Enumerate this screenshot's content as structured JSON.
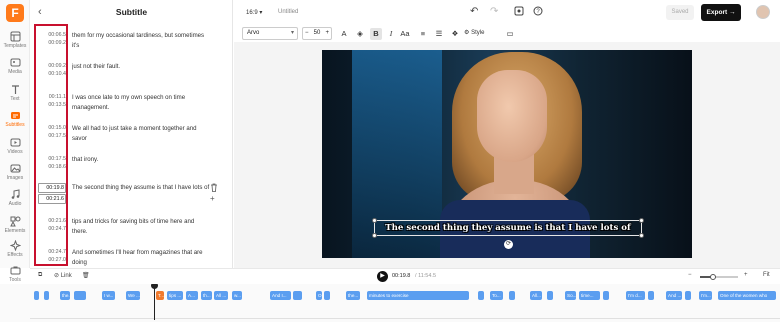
{
  "rail": {
    "logo": "F",
    "items": [
      {
        "label": "Templates",
        "icon": "templates-icon",
        "active": false
      },
      {
        "label": "Media",
        "icon": "media-icon",
        "active": false
      },
      {
        "label": "Text",
        "icon": "text-icon",
        "active": false
      },
      {
        "label": "Subtitles",
        "icon": "subtitles-icon",
        "active": true
      },
      {
        "label": "Videos",
        "icon": "videos-icon",
        "active": false
      },
      {
        "label": "Images",
        "icon": "images-icon",
        "active": false
      },
      {
        "label": "Audio",
        "icon": "audio-icon",
        "active": false
      },
      {
        "label": "Elements",
        "icon": "elements-icon",
        "active": false
      },
      {
        "label": "Effects",
        "icon": "effects-icon",
        "active": false
      },
      {
        "label": "Tools",
        "icon": "tools-icon",
        "active": false
      }
    ]
  },
  "panel": {
    "title": "Subtitle",
    "subtitles": [
      {
        "start": "00:06.5",
        "end": "00:09.2",
        "text": "them for my occasional tardiness, but sometimes it's"
      },
      {
        "start": "00:09.2",
        "end": "00:10.4",
        "text": "just not their fault."
      },
      {
        "start": "00:11.1",
        "end": "00:13.5",
        "text": "I was once late to my own speech on time management."
      },
      {
        "start": "00:15.0",
        "end": "00:17.5",
        "text": "We all had to just take a moment together and savor"
      },
      {
        "start": "00:17.5",
        "end": "00:18.6",
        "text": "that irony."
      },
      {
        "start": "00:19.8",
        "end_prefix": "00:",
        "end_sel": "21",
        "end_suffix": ".6",
        "text": "The second thing they assume is that I have lots of"
      },
      {
        "start": "00:21.6",
        "end": "00:24.7",
        "text": "tips and tricks for saving bits of time here and there."
      },
      {
        "start": "00:24.7",
        "end": "00:27.0",
        "text": "And sometimes I'll hear from magazines that are doing"
      }
    ]
  },
  "topbar": {
    "ratio": "16:9",
    "project_name": "Untitled",
    "saved_label": "Saved",
    "export_label": "Export"
  },
  "toolbar": {
    "font": "Arvo",
    "size": "50",
    "style_label": "Style"
  },
  "canvas": {
    "caption": "The second thing they assume is that I have lots of"
  },
  "controls": {
    "link_label": "Link",
    "current_time": "00:19.8",
    "total_time": "11:54.5",
    "fit_label": "Fit",
    "zoom_level": 0.35
  },
  "timeline": {
    "clips": [
      "",
      "",
      "the...",
      "",
      "I w...",
      "We ...",
      "T...",
      "tips ...",
      "A...",
      "th...",
      "All ...",
      "w...",
      "And I...",
      "",
      "O...",
      "",
      "the...",
      "minutes to exercise",
      "",
      "To...",
      "",
      "All...",
      "",
      "So...",
      "time...",
      "",
      "I'm d...",
      "",
      "And ...",
      "",
      "I'm...",
      "One of the women who"
    ]
  },
  "colors": {
    "accent": "#ff6a00",
    "highlight_box": "#c8102e",
    "clip": "#5b9ef0",
    "clip_selected": "#f07a2e"
  }
}
